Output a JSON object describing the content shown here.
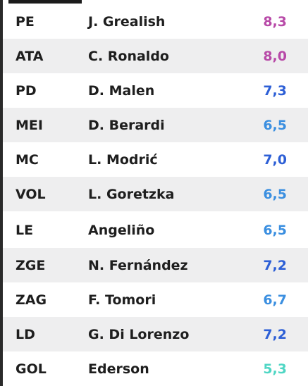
{
  "lineup": [
    {
      "position": "PE",
      "player": "J. Grealish",
      "rating": "8,3",
      "rating_color": "#b84aa8"
    },
    {
      "position": "ATA",
      "player": "C. Ronaldo",
      "rating": "8,0",
      "rating_color": "#b84aa8"
    },
    {
      "position": "PD",
      "player": "D. Malen",
      "rating": "7,3",
      "rating_color": "#2d5fd6"
    },
    {
      "position": "MEI",
      "player": "D. Berardi",
      "rating": "6,5",
      "rating_color": "#3b8fe0"
    },
    {
      "position": "MC",
      "player": "L. Modrić",
      "rating": "7,0",
      "rating_color": "#2d5fd6"
    },
    {
      "position": "VOL",
      "player": "L. Goretzka",
      "rating": "6,5",
      "rating_color": "#3b8fe0"
    },
    {
      "position": "LE",
      "player": "Angeliño",
      "rating": "6,5",
      "rating_color": "#3b8fe0"
    },
    {
      "position": "ZGE",
      "player": "N. Fernández",
      "rating": "7,2",
      "rating_color": "#2d5fd6"
    },
    {
      "position": "ZAG",
      "player": "F. Tomori",
      "rating": "6,7",
      "rating_color": "#3b8fe0"
    },
    {
      "position": "LD",
      "player": "G. Di Lorenzo",
      "rating": "7,2",
      "rating_color": "#2d5fd6"
    },
    {
      "position": "GOL",
      "player": "Ederson",
      "rating": "5,3",
      "rating_color": "#4fd6c4"
    }
  ]
}
